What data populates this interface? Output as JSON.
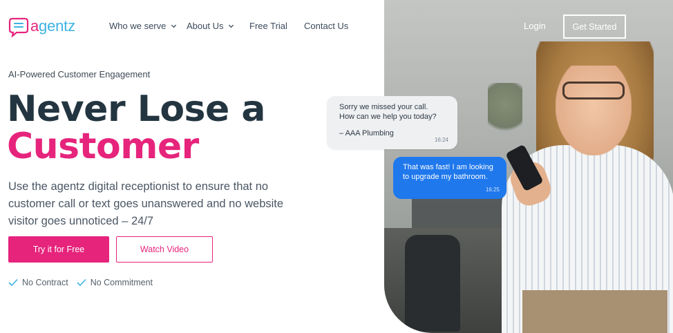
{
  "brand": {
    "logo_text_a": "a",
    "logo_text_rest": "gentz",
    "pink": "#e6247c",
    "blue": "#3bb3e4",
    "icon": "chat-bubble-logo-icon"
  },
  "nav": {
    "items": [
      {
        "label": "Who we serve",
        "has_dropdown": true
      },
      {
        "label": "About Us",
        "has_dropdown": true
      },
      {
        "label": "Free Trial",
        "has_dropdown": false
      },
      {
        "label": "Contact Us",
        "has_dropdown": false
      }
    ],
    "login": "Login",
    "get_started": "Get Started"
  },
  "hero": {
    "eyebrow": "AI-Powered Customer Engagement",
    "headline_line1": "Never Lose a",
    "headline_line2": "Customer",
    "subtext": "Use the agentz digital receptionist to ensure that no customer call or text goes unanswered and no website visitor goes unnoticed – 24/7",
    "primary_cta": "Try it for Free",
    "secondary_cta": "Watch Video",
    "perks": [
      "No Contract",
      "No Commitment"
    ]
  },
  "chat": {
    "incoming": {
      "line1": "Sorry we missed your call.",
      "line2": "How can we help you today?",
      "signature": "– AAA Plumbing",
      "time": "16:24"
    },
    "outgoing": {
      "line1": "That was fast!  I am looking",
      "line2": "to upgrade my bathroom.",
      "time": "16:25"
    }
  }
}
